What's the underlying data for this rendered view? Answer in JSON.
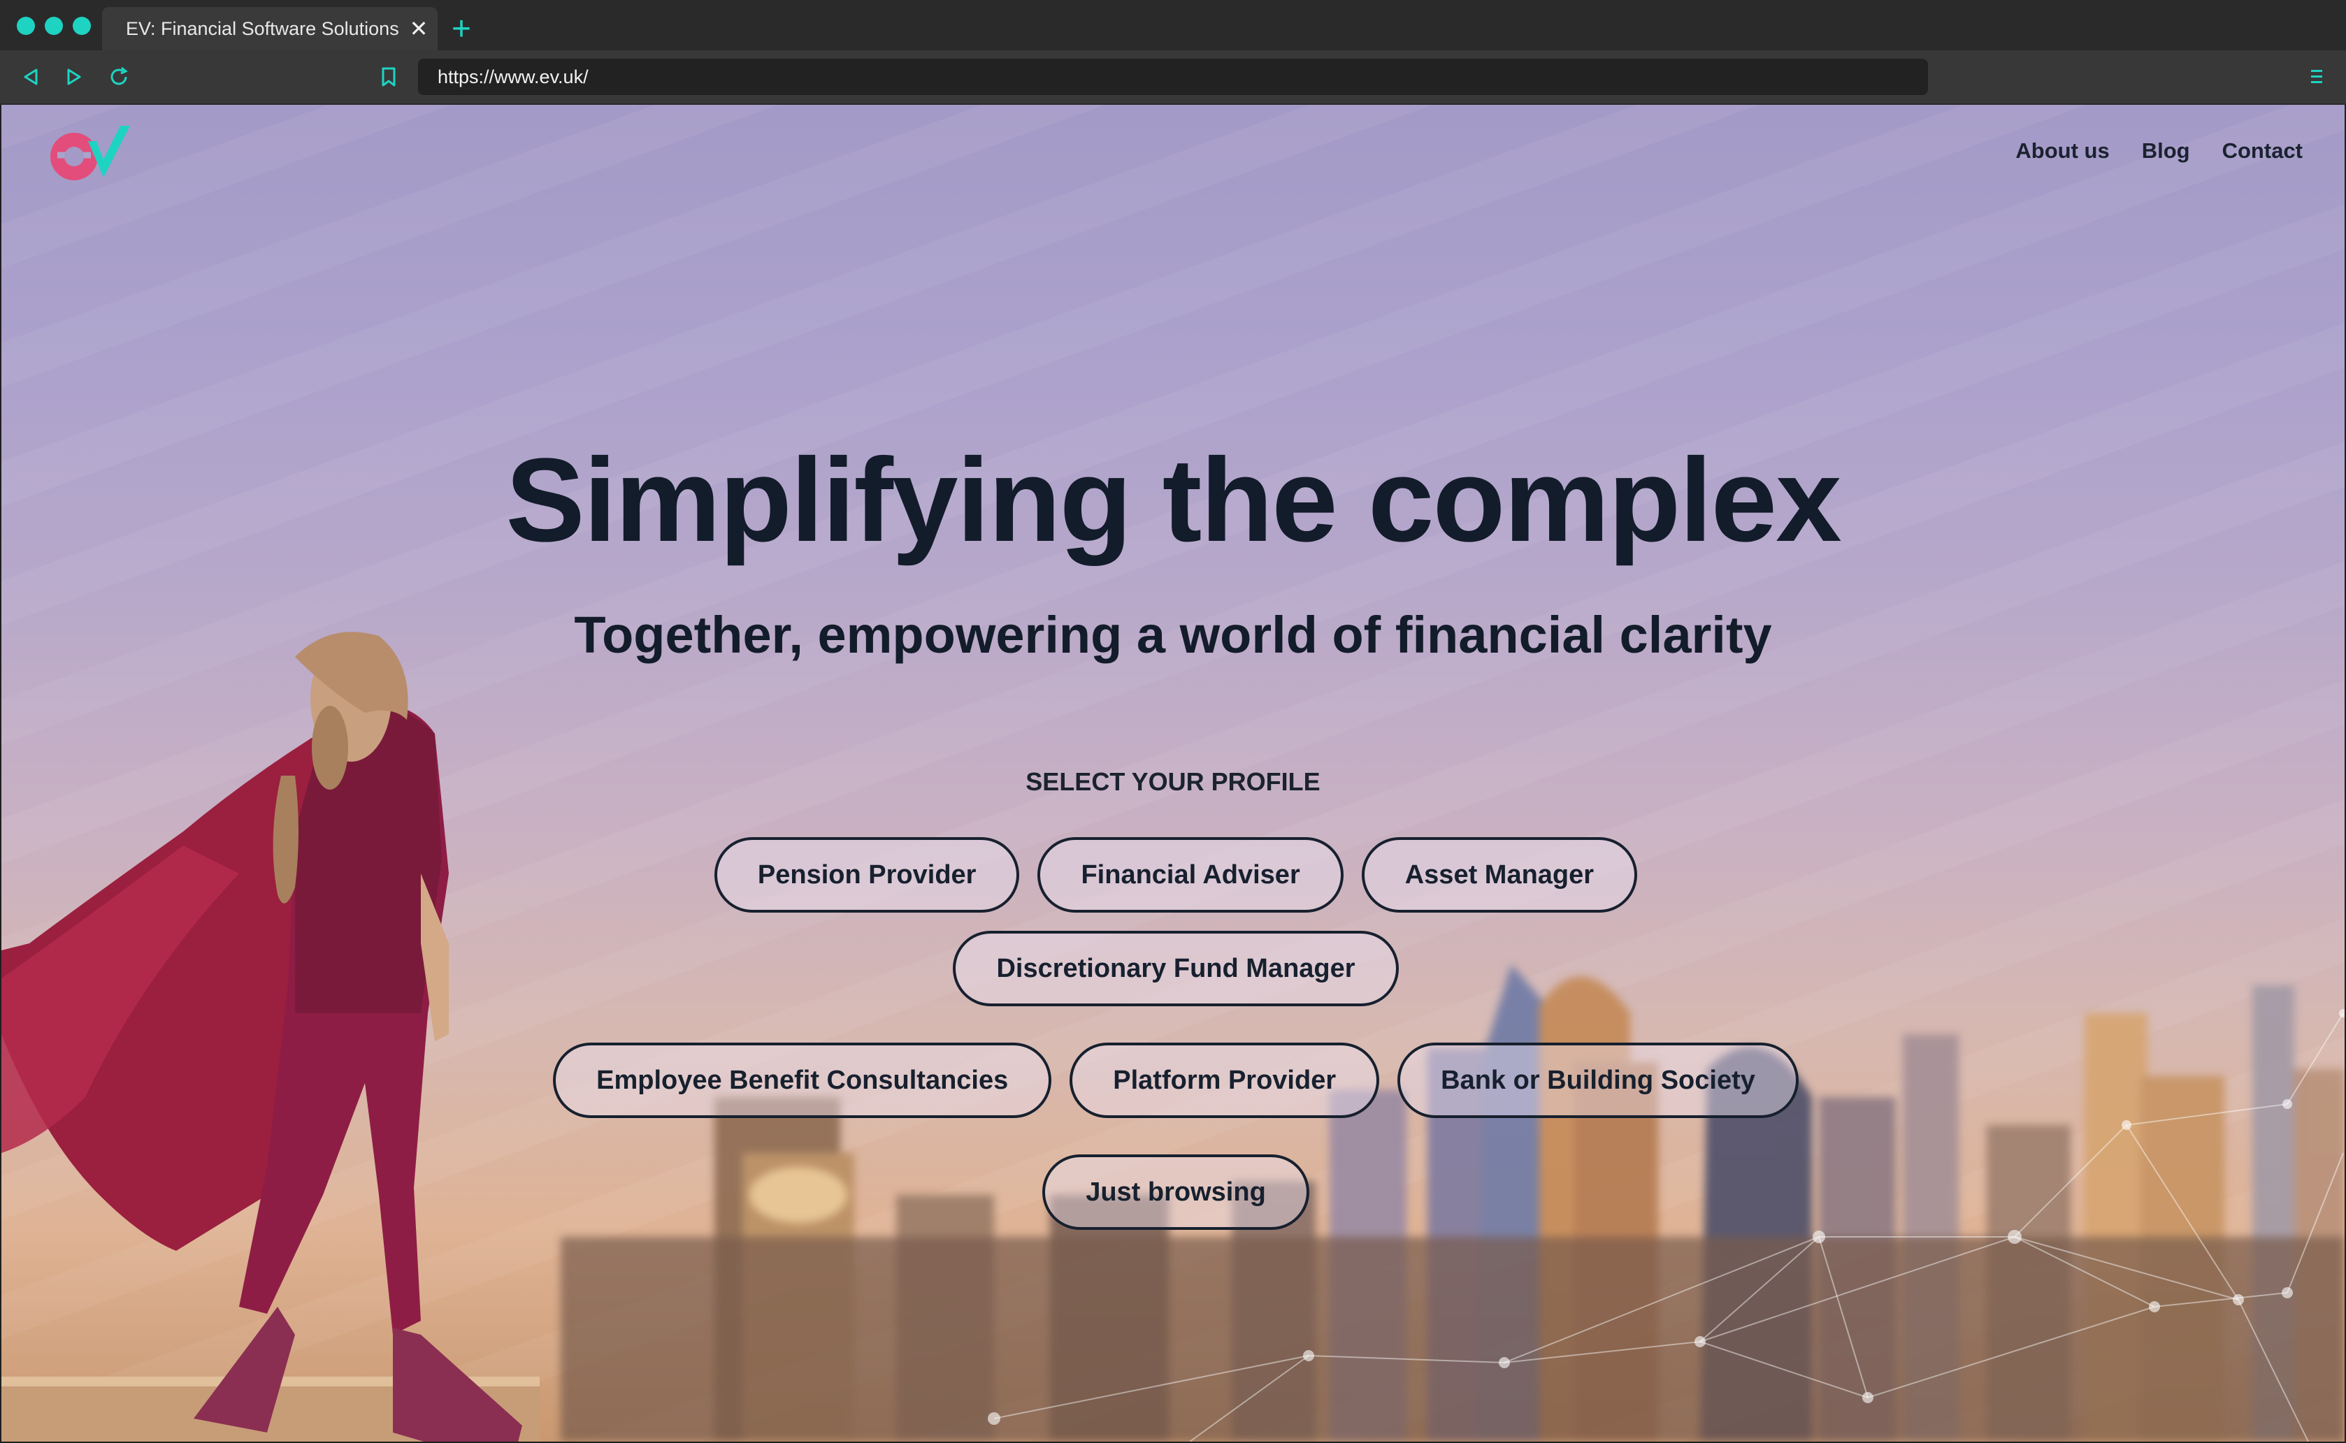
{
  "browser": {
    "tab_title": "EV: Financial Software Solutions",
    "tab_close": "✕",
    "new_tab": "+",
    "url": "https://www.ev.uk/",
    "accent_color": "#1ed3c2"
  },
  "site": {
    "logo_alt": "ev",
    "nav": [
      "About us",
      "Blog",
      "Contact"
    ]
  },
  "hero": {
    "title": "Simplifying the complex",
    "subtitle": "Together, empowering a world of financial clarity",
    "select_label": "SELECT YOUR PROFILE",
    "profiles_row1": [
      "Pension Provider",
      "Financial Adviser",
      "Asset Manager",
      "Discretionary Fund Manager"
    ],
    "profiles_row2": [
      "Employee Benefit Consultancies",
      "Platform Provider",
      "Bank or Building Society"
    ],
    "profiles_row3": [
      "Just browsing"
    ]
  }
}
